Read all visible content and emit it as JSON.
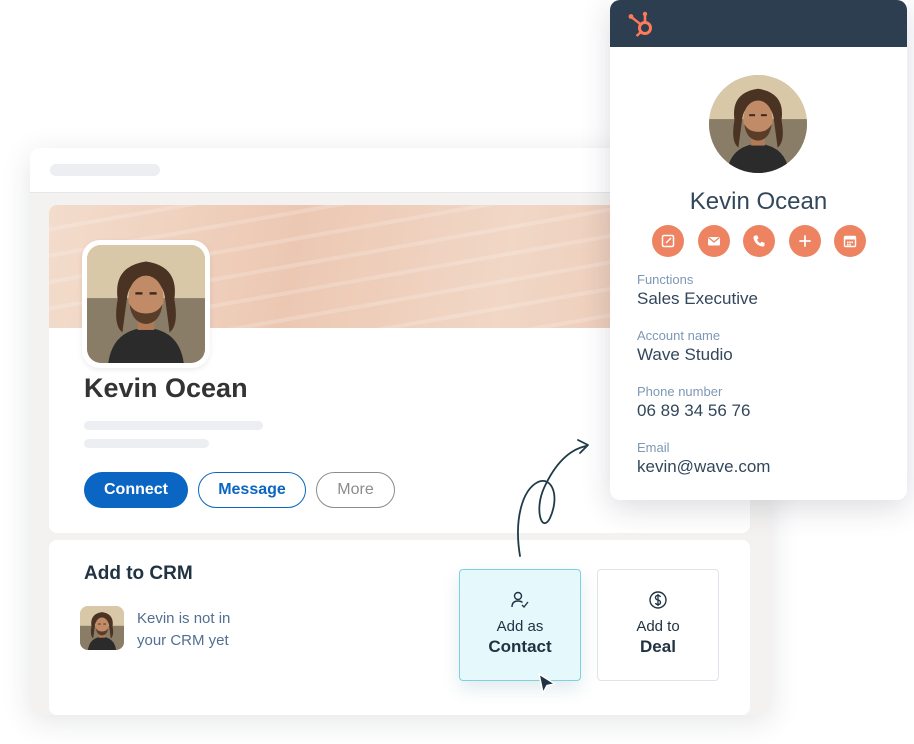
{
  "linkedin": {
    "profile_name": "Kevin Ocean",
    "buttons": {
      "connect": "Connect",
      "message": "Message",
      "more": "More"
    }
  },
  "crm": {
    "title": "Add to CRM",
    "note": "Kevin is not in your CRM yet",
    "options": [
      {
        "line1": "Add as",
        "line2": "Contact",
        "icon": "user-check-icon"
      },
      {
        "line1": "Add to",
        "line2": "Deal",
        "icon": "dollar-circle-icon"
      }
    ]
  },
  "hubspot": {
    "logo": "hubspot-sprocket-icon",
    "name": "Kevin Ocean",
    "actions": [
      "note-icon",
      "email-icon",
      "phone-icon",
      "plus-icon",
      "calendar-icon"
    ],
    "fields": [
      {
        "label": "Functions",
        "value": "Sales Executive"
      },
      {
        "label": "Account name",
        "value": "Wave Studio"
      },
      {
        "label": "Phone number",
        "value": "06 89 34 56 76"
      },
      {
        "label": "Email",
        "value": "kevin@wave.com"
      }
    ]
  },
  "colors": {
    "linkedin_blue": "#0a66c2",
    "hubspot_orange": "#ff7a59",
    "hubspot_action": "#ee8361",
    "hubspot_header": "#2d3e50",
    "contact_highlight": "#e5f8fb"
  }
}
